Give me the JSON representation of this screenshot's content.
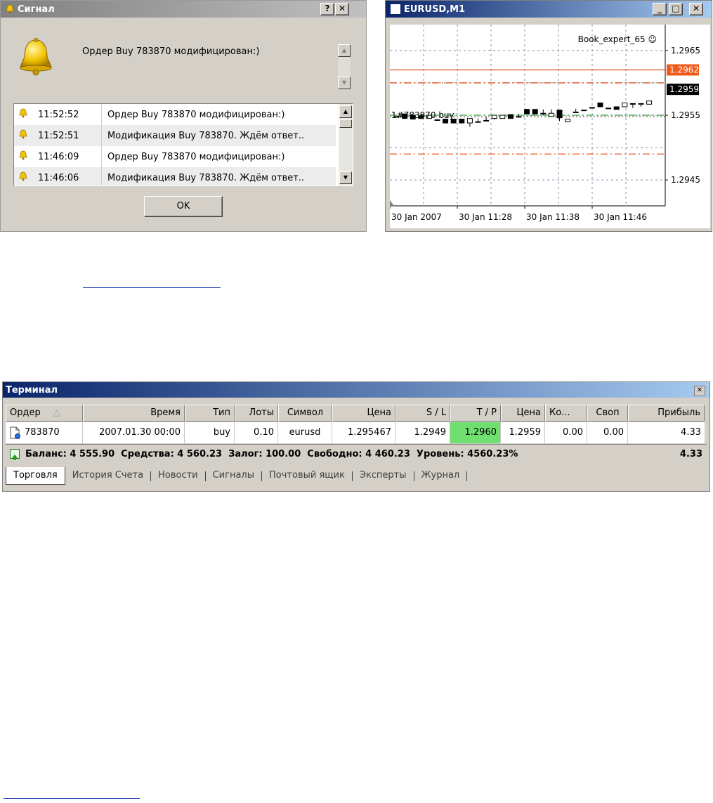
{
  "signal_window": {
    "title": "Сигнал",
    "help_button": "?",
    "close_button": "✕",
    "message": "Ордер Buy 783870 модифицирован:)",
    "log": [
      {
        "time": "11:52:52",
        "text": "Ордер Buy 783870 модифицирован:)"
      },
      {
        "time": "11:52:51",
        "text": "Модификация Buy 783870. Ждём ответ.."
      },
      {
        "time": "11:46:09",
        "text": "Ордер Buy 783870 модифицирован:)"
      },
      {
        "time": "11:46:06",
        "text": "Модификация Buy 783870. Ждём ответ.."
      }
    ],
    "ok_label": "OK"
  },
  "chart_window": {
    "title": "EURUSD,M1",
    "min_button": "_",
    "max_button": "□",
    "close_button": "✕",
    "expert_label": "Book_expert_65 ☺",
    "order_label": "1#783870 buy",
    "price_labels": {
      "tp_marker": "1.2962",
      "bid_marker": "1.2959"
    },
    "colors": {
      "tp_line": "#e8501a",
      "order_line": "#2a9a2a",
      "bid_bg": "#000000",
      "tp_bg": "#f05a1a"
    }
  },
  "chart_data": {
    "type": "candlestick",
    "symbol": "EURUSD",
    "timeframe": "M1",
    "y_ticks": [
      1.2965,
      1.2955,
      1.2945
    ],
    "x_ticks": [
      "30 Jan 2007",
      "30 Jan 11:28",
      "30 Jan 11:38",
      "30 Jan 11:46"
    ],
    "ylim": [
      1.2941,
      1.2969
    ],
    "grid": true,
    "levels": {
      "take_profit": 1.2962,
      "tp_dash_upper": 1.296,
      "order_open": 1.2955,
      "stop_loss": 1.2949,
      "bid": 1.2959
    },
    "candles": [
      {
        "o": 1.29548,
        "c": 1.29548,
        "h": 1.29548,
        "l": 1.29548
      },
      {
        "o": 1.29552,
        "c": 1.29545,
        "h": 1.29552,
        "l": 1.29545
      },
      {
        "o": 1.2955,
        "c": 1.29544,
        "h": 1.2955,
        "l": 1.29544
      },
      {
        "o": 1.29549,
        "c": 1.29545,
        "h": 1.29552,
        "l": 1.29544
      },
      {
        "o": 1.29545,
        "c": 1.2955,
        "h": 1.2955,
        "l": 1.29545
      },
      {
        "o": 1.29543,
        "c": 1.29543,
        "h": 1.29543,
        "l": 1.29543
      },
      {
        "o": 1.29544,
        "c": 1.29538,
        "h": 1.29544,
        "l": 1.29538
      },
      {
        "o": 1.29544,
        "c": 1.29538,
        "h": 1.29544,
        "l": 1.29538
      },
      {
        "o": 1.29544,
        "c": 1.29538,
        "h": 1.29544,
        "l": 1.29538
      },
      {
        "o": 1.29538,
        "c": 1.29545,
        "h": 1.29545,
        "l": 1.29532
      },
      {
        "o": 1.2954,
        "c": 1.2954,
        "h": 1.29545,
        "l": 1.2954
      },
      {
        "o": 1.29542,
        "c": 1.29542,
        "h": 1.29548,
        "l": 1.29542
      },
      {
        "o": 1.29545,
        "c": 1.2955,
        "h": 1.2955,
        "l": 1.29543
      },
      {
        "o": 1.29545,
        "c": 1.2955,
        "h": 1.2955,
        "l": 1.29545
      },
      {
        "o": 1.29551,
        "c": 1.29545,
        "h": 1.29551,
        "l": 1.29545
      },
      {
        "o": 1.29548,
        "c": 1.29548,
        "h": 1.29552,
        "l": 1.29548
      },
      {
        "o": 1.29559,
        "c": 1.29552,
        "h": 1.29559,
        "l": 1.29552
      },
      {
        "o": 1.29559,
        "c": 1.29552,
        "h": 1.29559,
        "l": 1.29552
      },
      {
        "o": 1.29553,
        "c": 1.29553,
        "h": 1.29559,
        "l": 1.2955
      },
      {
        "o": 1.29548,
        "c": 1.29553,
        "h": 1.29559,
        "l": 1.29548
      },
      {
        "o": 1.29558,
        "c": 1.29546,
        "h": 1.29558,
        "l": 1.29541
      },
      {
        "o": 1.2954,
        "c": 1.29544,
        "h": 1.29544,
        "l": 1.2954
      },
      {
        "o": 1.29555,
        "c": 1.29555,
        "h": 1.2956,
        "l": 1.29555
      },
      {
        "o": 1.29558,
        "c": 1.29558,
        "h": 1.29558,
        "l": 1.29558
      },
      {
        "o": 1.29562,
        "c": 1.29562,
        "h": 1.29562,
        "l": 1.29562
      },
      {
        "o": 1.29569,
        "c": 1.29563,
        "h": 1.29569,
        "l": 1.29563
      },
      {
        "o": 1.29561,
        "c": 1.29561,
        "h": 1.29561,
        "l": 1.29561
      },
      {
        "o": 1.29563,
        "c": 1.29559,
        "h": 1.29563,
        "l": 1.29559
      },
      {
        "o": 1.29563,
        "c": 1.29569,
        "h": 1.29569,
        "l": 1.29563
      },
      {
        "o": 1.29568,
        "c": 1.29568,
        "h": 1.29568,
        "l": 1.29561
      },
      {
        "o": 1.29568,
        "c": 1.29568,
        "h": 1.29568,
        "l": 1.29563
      },
      {
        "o": 1.29567,
        "c": 1.29572,
        "h": 1.29572,
        "l": 1.29567
      }
    ]
  },
  "terminal": {
    "title": "Терминал",
    "close_button": "✕",
    "columns": [
      "Ордер",
      "Время",
      "Тип",
      "Лоты",
      "Символ",
      "Цена",
      "S / L",
      "T / P",
      "Цена",
      "Ко...",
      "Своп",
      "Прибыль"
    ],
    "sort_indicator": "△",
    "row": {
      "order": "783870",
      "time": "2007.01.30 00:00",
      "type": "buy",
      "lots": "0.10",
      "symbol": "eurusd",
      "price": "1.295467",
      "sl": "1.2949",
      "tp": "1.2960",
      "cur_price": "1.2959",
      "commission": "0.00",
      "swap": "0.00",
      "profit": "4.33"
    },
    "summary": "Баланс: 4 555.90  Средства: 4 560.23  Залог: 100.00  Свободно: 4 460.23  Уровень: 4560.23%",
    "summary_profit": "4.33",
    "tabs": [
      "Торговля",
      "История Счета",
      "Новости",
      "Сигналы",
      "Почтовый ящик",
      "Эксперты",
      "Журнал"
    ],
    "colors": {
      "tp_highlight": "#6fe06f"
    }
  }
}
